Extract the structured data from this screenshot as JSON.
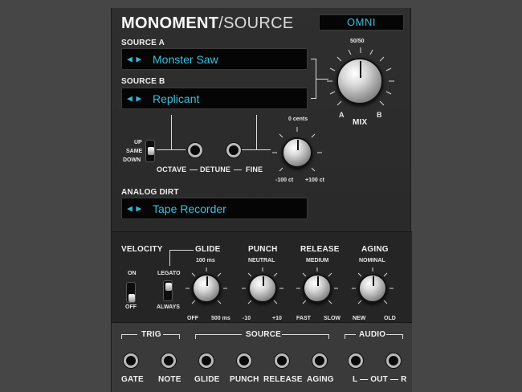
{
  "header": {
    "title_bold": "MONOMENT",
    "title_light": "/SOURCE",
    "omni": "OMNI"
  },
  "source_a": {
    "label": "SOURCE A",
    "arrows": "◀ ▶",
    "value": "Monster Saw"
  },
  "source_b": {
    "label": "SOURCE B",
    "arrows": "◀ ▶",
    "value": "Replicant"
  },
  "mix": {
    "label": "MIX",
    "center": "50/50",
    "left": "A",
    "right": "B"
  },
  "octave": {
    "up": "UP",
    "same": "SAME",
    "down": "DOWN",
    "label": "OCTAVE"
  },
  "detune": {
    "label": "DETUNE"
  },
  "fine": {
    "label": "FINE",
    "top": "0 cents",
    "min": "-100 ct",
    "max": "+100 ct"
  },
  "analog_dirt": {
    "label": "ANALOG DIRT",
    "arrows": "◀ ▶",
    "value": "Tape Recorder"
  },
  "velocity": {
    "label": "VELOCITY",
    "on": "ON",
    "off": "OFF"
  },
  "glide": {
    "label": "GLIDE",
    "top": "100 ms",
    "legato": "LEGATO",
    "always": "ALWAYS",
    "min": "OFF",
    "max": "500 ms"
  },
  "punch": {
    "label": "PUNCH",
    "top": "NEUTRAL",
    "min": "-10",
    "max": "+10"
  },
  "release": {
    "label": "RELEASE",
    "top": "MEDIUM",
    "min": "FAST",
    "max": "SLOW"
  },
  "aging": {
    "label": "AGING",
    "top": "NOMINAL",
    "min": "NEW",
    "max": "OLD"
  },
  "bottom": {
    "trig": "TRIG",
    "source": "SOURCE",
    "audio": "AUDIO",
    "jacks": [
      "GATE",
      "NOTE",
      "GLIDE",
      "PUNCH",
      "RELEASE",
      "AGING"
    ],
    "audio_label": "L — OUT — R"
  }
}
